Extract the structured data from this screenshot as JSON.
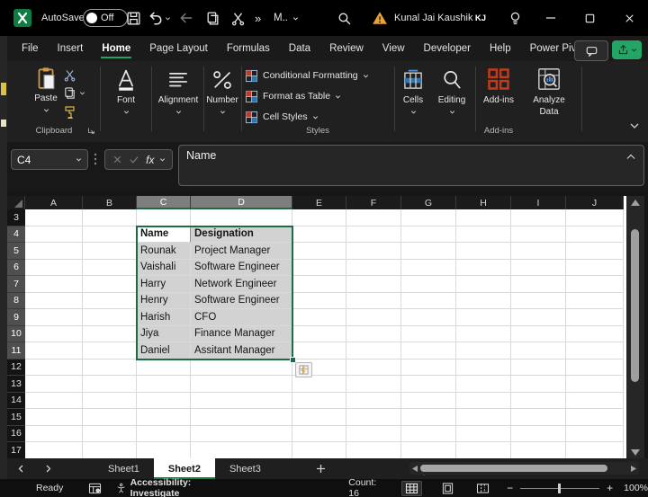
{
  "titlebar": {
    "autosave_label": "AutoSave",
    "autosave_state": "Off",
    "overflow_glyph": "»",
    "window_title": "M..",
    "user_name": "Kunal Jai Kaushik",
    "avatar_initials": "KJ"
  },
  "menu": {
    "items": [
      {
        "label": "File",
        "active": false
      },
      {
        "label": "Insert",
        "active": false
      },
      {
        "label": "Home",
        "active": true
      },
      {
        "label": "Page Layout",
        "active": false
      },
      {
        "label": "Formulas",
        "active": false
      },
      {
        "label": "Data",
        "active": false
      },
      {
        "label": "Review",
        "active": false
      },
      {
        "label": "View",
        "active": false
      },
      {
        "label": "Developer",
        "active": false
      },
      {
        "label": "Help",
        "active": false
      },
      {
        "label": "Power Pivot",
        "active": false
      }
    ]
  },
  "ribbon": {
    "paste_label": "Paste",
    "clipboard_group": "Clipboard",
    "font_label": "Font",
    "alignment_label": "Alignment",
    "number_label": "Number",
    "styles_items": [
      "Conditional Formatting",
      "Format as Table",
      "Cell Styles"
    ],
    "styles_group": "Styles",
    "cells_label": "Cells",
    "editing_label": "Editing",
    "addins_label": "Add-ins",
    "addins_group": "Add-ins",
    "analyze_label": "Analyze Data"
  },
  "formula_bar": {
    "name_box": "C4",
    "fx_label": "fx",
    "input_text": "Name"
  },
  "grid": {
    "columns": [
      {
        "label": "A",
        "w": 64
      },
      {
        "label": "B",
        "w": 60
      },
      {
        "label": "C",
        "w": 60
      },
      {
        "label": "D",
        "w": 113
      },
      {
        "label": "E",
        "w": 60
      },
      {
        "label": "F",
        "w": 61
      },
      {
        "label": "G",
        "w": 61
      },
      {
        "label": "H",
        "w": 61
      },
      {
        "label": "I",
        "w": 61
      },
      {
        "label": "J",
        "w": 64
      }
    ],
    "row_start": 3,
    "row_end": 17,
    "selected_columns": [
      "C",
      "D"
    ],
    "selected_row_range": [
      4,
      11
    ],
    "active_cell": "C4",
    "table": {
      "origin_row": 4,
      "col_keys": [
        "C",
        "D"
      ],
      "rows": [
        [
          "Name",
          "Designation"
        ],
        [
          "Rounak",
          "Project Manager"
        ],
        [
          "Vaishali",
          "Software Engineer"
        ],
        [
          "Harry",
          "Network Engineer"
        ],
        [
          "Henry",
          "Software Engineer"
        ],
        [
          "Harish",
          "CFO"
        ],
        [
          "Jiya",
          "Finance Manager"
        ],
        [
          "Daniel",
          "Assitant Manager"
        ]
      ]
    }
  },
  "sheet_tabs": {
    "tabs": [
      {
        "label": "Sheet1",
        "active": false
      },
      {
        "label": "Sheet2",
        "active": true
      },
      {
        "label": "Sheet3",
        "active": false
      }
    ]
  },
  "status_bar": {
    "ready": "Ready",
    "accessibility": "Accessibility: Investigate",
    "count": "Count: 16",
    "zoom_minus": "−",
    "zoom_plus": "+",
    "zoom_level": "100%"
  },
  "colors": {
    "accent_green": "#107c41",
    "underline_green": "#21a366",
    "selection_border": "#1d6b45",
    "avatar_gold": "#b3900e",
    "warning_yellow": "#e9a13b",
    "addins_red": "#c13b1a"
  }
}
